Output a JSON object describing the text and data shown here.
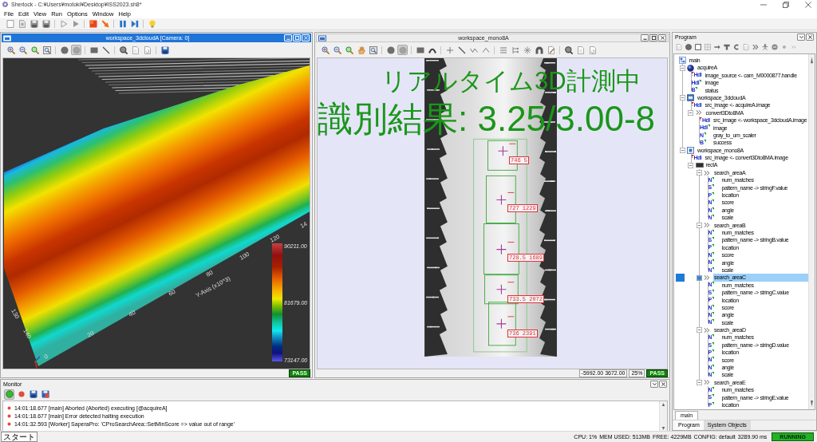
{
  "window": {
    "title": "Sherlock - C:¥Users¥motoki¥Desktop¥ISS2023.sh8*"
  },
  "menu": [
    "File",
    "Edit",
    "View",
    "Run",
    "Options",
    "Window",
    "Help"
  ],
  "workspace_3d": {
    "title": "workspace_3dcloudA [Camera: 0]",
    "active": true,
    "toolbar": [
      {
        "pressed": false
      },
      {
        "pressed": false
      },
      {
        "pressed": false
      },
      {
        "pressed": false
      },
      {
        "pressed": false
      },
      {
        "pressed": true
      },
      {
        "pressed": false
      },
      {
        "pressed": false
      },
      {
        "pressed": false
      },
      {
        "pressed": false
      },
      {
        "pressed": false
      },
      {
        "pressed": false
      }
    ],
    "plot": {
      "axis_title": "Y-Axis (x10^3)",
      "y_ticks": [
        "0",
        "20",
        "40",
        "60",
        "80",
        "100",
        "120",
        "14"
      ],
      "x_ticks": [
        "140",
        "130"
      ],
      "scale_labels": [
        "90211.00",
        "81679.00",
        "73147.00"
      ]
    },
    "result": "PASS"
  },
  "workspace_mono": {
    "title": "workspace_mono8A",
    "active": false,
    "toolbar": [
      {
        "pressed": false
      },
      {
        "pressed": false
      },
      {
        "pressed": false
      },
      {
        "pressed": false
      },
      {
        "pressed": false
      },
      {
        "pressed": false
      },
      {
        "pressed": true
      },
      {
        "pressed": false
      },
      {
        "pressed": false
      },
      {
        "pressed": false
      },
      {
        "pressed": false
      },
      {
        "pressed": false
      },
      {
        "pressed": false
      },
      {
        "pressed": false
      },
      {
        "pressed": false
      },
      {
        "pressed": false
      },
      {
        "pressed": false
      },
      {
        "pressed": false
      },
      {
        "pressed": false
      },
      {
        "pressed": false
      },
      {
        "pressed": false
      }
    ],
    "overlay_text": [
      "リアルタイム3D計測中",
      "識別結果: 3.25/3.00-8"
    ],
    "matches": [
      {
        "label": "746 5"
      },
      {
        "label": "727 1229"
      },
      {
        "label": "728.5 1689"
      },
      {
        "label": "733.5 2072"
      },
      {
        "label": "736 2391"
      }
    ],
    "coordinates": "-5992.00 3672.00",
    "zoom": "25%",
    "result": "PASS"
  },
  "program": {
    "title": "Program",
    "tree": [
      {
        "label": "main",
        "kind": "main",
        "selected": false,
        "children": [
          {
            "label": "acquireA",
            "kind": "acquire",
            "expanded": true,
            "selected": false,
            "children": [
              {
                "label": "image_source <- cam_M0000877.handle",
                "kind": "input",
                "type": "Hdl",
                "selected": false
              },
              {
                "label": "image",
                "kind": "output",
                "type": "Hdl",
                "selected": false
              },
              {
                "label": "status",
                "kind": "output",
                "type": "B",
                "selected": false
              }
            ]
          },
          {
            "label": "workspace_3dcloudA",
            "kind": "cloud",
            "expanded": true,
            "selected": false,
            "children": [
              {
                "label": "src_image <- acquireA.image",
                "kind": "input",
                "type": "Hdl",
                "selected": false
              },
              {
                "label": "convert3Dto8MA",
                "kind": "tool",
                "expanded": true,
                "selected": false,
                "children": [
                  {
                    "label": "src_image <- workspace_3dcloudA.image",
                    "kind": "input",
                    "type": "Hdl",
                    "selected": false
                  },
                  {
                    "label": "image",
                    "kind": "output",
                    "type": "Hdl",
                    "selected": false
                  },
                  {
                    "label": "gray_to_um_scaler",
                    "kind": "output",
                    "type": "N",
                    "selected": false
                  },
                  {
                    "label": "success",
                    "kind": "output",
                    "type": "B",
                    "selected": false
                  }
                ]
              }
            ]
          },
          {
            "label": "workspace_mono8A",
            "kind": "mono",
            "expanded": true,
            "selected": false,
            "children": [
              {
                "label": "src_image <- convert3Dto8MA.image",
                "kind": "input",
                "type": "Hdl",
                "selected": false
              },
              {
                "label": "rectA",
                "kind": "roi",
                "expanded": true,
                "selected": false,
                "children": [
                  {
                    "label": "search_areaA",
                    "kind": "tool",
                    "expanded": true,
                    "selected": false,
                    "children": [
                      {
                        "label": "num_matches",
                        "kind": "output",
                        "type": "N",
                        "selected": false
                      },
                      {
                        "label": "pattern_name -> stringF.value",
                        "kind": "output",
                        "type": "S",
                        "selected": false
                      },
                      {
                        "label": "location",
                        "kind": "output",
                        "type": "P",
                        "selected": false
                      },
                      {
                        "label": "score",
                        "kind": "output",
                        "type": "N",
                        "selected": false
                      },
                      {
                        "label": "angle",
                        "kind": "output",
                        "type": "N",
                        "selected": false
                      },
                      {
                        "label": "scale",
                        "kind": "output",
                        "type": "N",
                        "selected": false
                      }
                    ]
                  },
                  {
                    "label": "search_areaB",
                    "kind": "tool",
                    "expanded": true,
                    "selected": false,
                    "children": [
                      {
                        "label": "num_matches",
                        "kind": "output",
                        "type": "N",
                        "selected": false
                      },
                      {
                        "label": "pattern_name -> stringB.value",
                        "kind": "output",
                        "type": "S",
                        "selected": false
                      },
                      {
                        "label": "location",
                        "kind": "output",
                        "type": "P",
                        "selected": false
                      },
                      {
                        "label": "score",
                        "kind": "output",
                        "type": "N",
                        "selected": false
                      },
                      {
                        "label": "angle",
                        "kind": "output",
                        "type": "N",
                        "selected": false
                      },
                      {
                        "label": "scale",
                        "kind": "output",
                        "type": "N",
                        "selected": false
                      }
                    ]
                  },
                  {
                    "label": "search_areaC",
                    "kind": "tool",
                    "expanded": true,
                    "selected": true,
                    "children": [
                      {
                        "label": "num_matches",
                        "kind": "output",
                        "type": "N",
                        "selected": false
                      },
                      {
                        "label": "pattern_name -> stringC.value",
                        "kind": "output",
                        "type": "S",
                        "selected": false
                      },
                      {
                        "label": "location",
                        "kind": "output",
                        "type": "P",
                        "selected": false
                      },
                      {
                        "label": "score",
                        "kind": "output",
                        "type": "N",
                        "selected": false
                      },
                      {
                        "label": "angle",
                        "kind": "output",
                        "type": "N",
                        "selected": false
                      },
                      {
                        "label": "scale",
                        "kind": "output",
                        "type": "N",
                        "selected": false
                      }
                    ]
                  },
                  {
                    "label": "search_areaD",
                    "kind": "tool",
                    "expanded": true,
                    "selected": false,
                    "children": [
                      {
                        "label": "num_matches",
                        "kind": "output",
                        "type": "N",
                        "selected": false
                      },
                      {
                        "label": "pattern_name -> stringD.value",
                        "kind": "output",
                        "type": "S",
                        "selected": false
                      },
                      {
                        "label": "location",
                        "kind": "output",
                        "type": "P",
                        "selected": false
                      },
                      {
                        "label": "score",
                        "kind": "output",
                        "type": "N",
                        "selected": false
                      },
                      {
                        "label": "angle",
                        "kind": "output",
                        "type": "N",
                        "selected": false
                      },
                      {
                        "label": "scale",
                        "kind": "output",
                        "type": "N",
                        "selected": false
                      }
                    ]
                  },
                  {
                    "label": "search_areaE",
                    "kind": "tool",
                    "expanded": true,
                    "selected": false,
                    "children": [
                      {
                        "label": "num_matches",
                        "kind": "output",
                        "type": "N",
                        "selected": false
                      },
                      {
                        "label": "pattern_name -> stringE.value",
                        "kind": "output",
                        "type": "S",
                        "selected": false
                      },
                      {
                        "label": "location",
                        "kind": "output",
                        "type": "P",
                        "selected": false
                      }
                    ]
                  }
                ]
              }
            ]
          }
        ]
      }
    ],
    "sheet_tabs": [
      {
        "label": "main",
        "selected": true
      }
    ],
    "tabs": [
      {
        "label": "Program",
        "selected": true
      },
      {
        "label": "System Objects",
        "selected": false
      }
    ]
  },
  "monitor": {
    "title": "Monitor",
    "toolbar": [
      {
        "pressed": true
      },
      {
        "pressed": false
      },
      {
        "pressed": false
      },
      {
        "pressed": false
      }
    ],
    "log": [
      {
        "kind": "error",
        "text": "14:01:18.677 [main] Aborted (Aborted) executing [@acquireA]"
      },
      {
        "kind": "error",
        "text": "14:01:18.677 [main] Error detected halting execution"
      },
      {
        "kind": "error",
        "text": "14:01:32.593 [Worker] SaperaPro: 'CProSearchArea::SetMinScore => value out of range'"
      }
    ]
  },
  "status_bar": {
    "tooltip": "スタート",
    "cpu": "CPU: 1%",
    "memory": "MEM USED: 513MB",
    "free": "FREE: 4229MB",
    "config": "CONFIG: default",
    "time": "3289.90 ms",
    "state": "RUNNING"
  }
}
